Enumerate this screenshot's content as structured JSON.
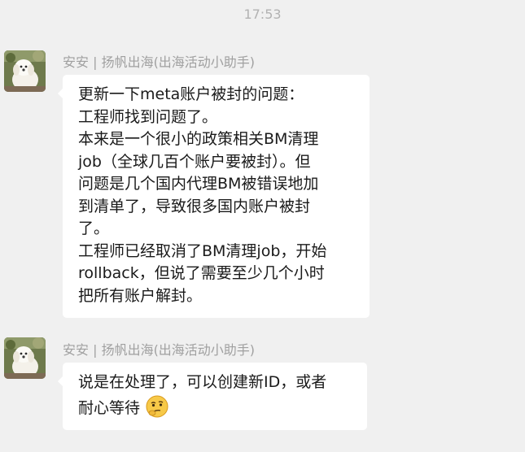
{
  "timestamp": "17:53",
  "messages": [
    {
      "sender": "安安 | 扬帆出海(出海活动小助手)",
      "text": "更新一下meta账户被封的问题：\n工程师找到问题了。\n本来是一个很小的政策相关BM清理\njob（全球几百个账户要被封）。但\n问题是几个国内代理BM被错误地加\n到清单了，导致很多国内账户被封\n了。\n工程师已经取消了BM清理job，开始\nrollback，但说了需要至少几个小时\n把所有账户解封。"
    },
    {
      "sender": "安安 | 扬帆出海(出海活动小助手)",
      "text": "说是在处理了，可以创建新ID，或者\n耐心等待",
      "emoji": "thinking-face-icon"
    }
  ]
}
